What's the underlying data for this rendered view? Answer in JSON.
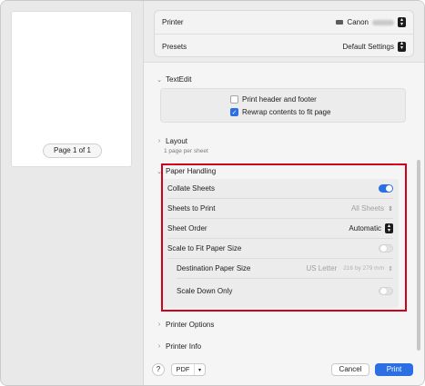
{
  "preview": {
    "page_indicator": "Page 1 of 1"
  },
  "top": {
    "printer_label": "Printer",
    "printer_value": "Canon",
    "presets_label": "Presets",
    "presets_value": "Default Settings"
  },
  "textedit": {
    "title": "TextEdit",
    "options": [
      {
        "label": "Print header and footer",
        "checked": false
      },
      {
        "label": "Rewrap contents to fit page",
        "checked": true
      }
    ]
  },
  "layout": {
    "title": "Layout",
    "subtitle": "1 page per sheet"
  },
  "paper_handling": {
    "title": "Paper Handling",
    "collate_label": "Collate Sheets",
    "collate_on": true,
    "sheets_label": "Sheets to Print",
    "sheets_value": "All Sheets",
    "order_label": "Sheet Order",
    "order_value": "Automatic",
    "scale_label": "Scale to Fit Paper Size",
    "scale_on": false,
    "dest_label": "Destination Paper Size",
    "dest_value": "US Letter",
    "dest_dims": "216 by 279 mm",
    "scale_down_label": "Scale Down Only",
    "scale_down_on": false
  },
  "printer_options": {
    "title": "Printer Options"
  },
  "printer_info": {
    "title": "Printer Info"
  },
  "footer": {
    "help_label": "?",
    "pdf_label": "PDF",
    "cancel_label": "Cancel",
    "print_label": "Print"
  },
  "colors": {
    "accent": "#2b6fe2",
    "highlight": "#d0021b"
  },
  "icons": [
    "printer-icon",
    "chevron-down-icon",
    "chevron-right-icon",
    "checkbox-checked-icon",
    "stepper-icon"
  ]
}
